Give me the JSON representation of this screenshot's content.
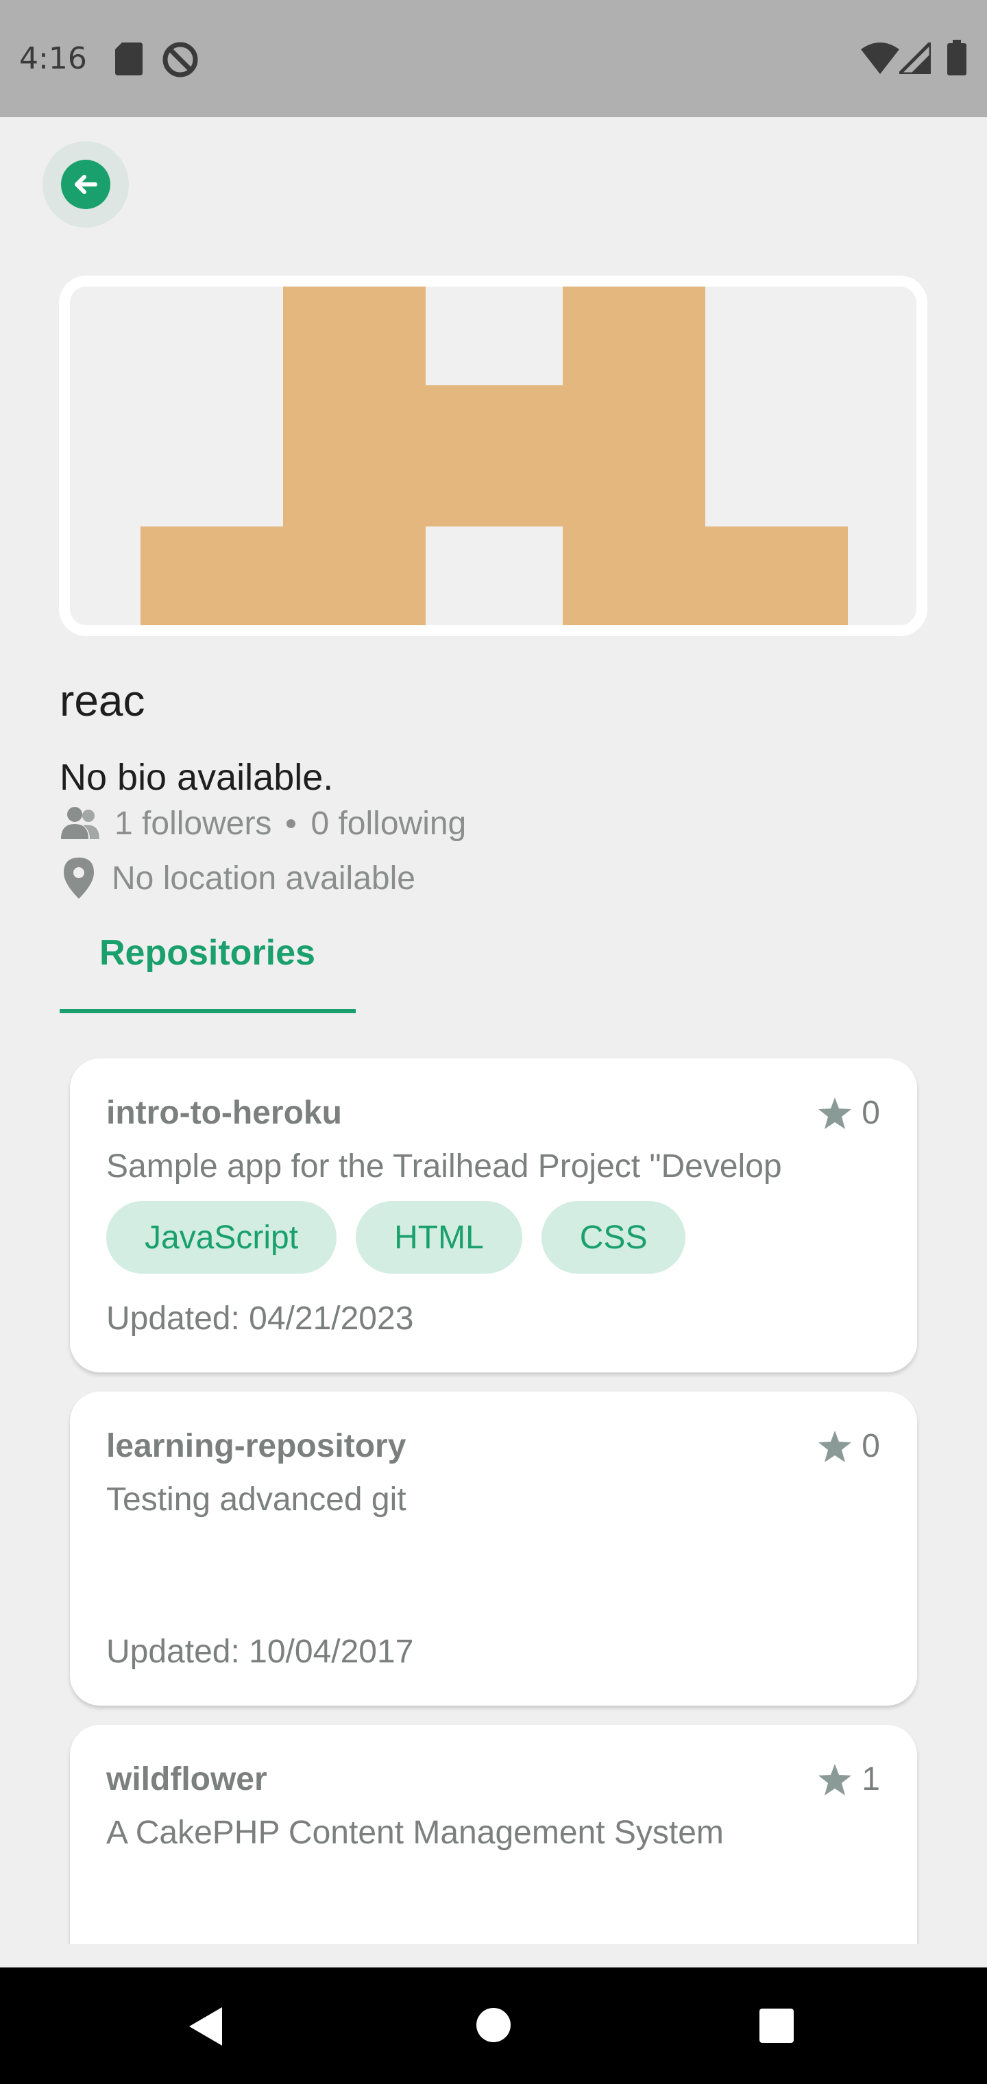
{
  "status_bar": {
    "time": "4:16",
    "icons": [
      "sd-card-icon",
      "do-not-disturb-icon",
      "wifi-icon",
      "signal-icon",
      "battery-icon"
    ]
  },
  "colors": {
    "accent": "#1aa06d",
    "chip_bg": "#d3ede3",
    "avatar_fill": "#e3b77e",
    "muted_text": "#7b7f7d"
  },
  "header": {
    "back_icon": "arrow-left-icon"
  },
  "profile": {
    "username": "reac",
    "bio": "No bio available.",
    "followers": "1 followers",
    "following": "0 following",
    "location": "No location available"
  },
  "tabs": [
    {
      "label": "Repositories",
      "selected": true
    }
  ],
  "repositories": [
    {
      "name": "intro-to-heroku",
      "stars": "0",
      "description": "Sample app for the Trailhead Project \"Develop",
      "languages": [
        "JavaScript",
        "HTML",
        "CSS"
      ],
      "updated": "Updated: 04/21/2023"
    },
    {
      "name": "learning-repository",
      "stars": "0",
      "description": "Testing advanced git",
      "languages": [],
      "updated": "Updated: 10/04/2017"
    },
    {
      "name": "wildflower",
      "stars": "1",
      "description": "A CakePHP Content Management System",
      "languages": [],
      "updated": ""
    }
  ],
  "nav_bar": {
    "buttons": [
      "back-triangle-icon",
      "home-circle-icon",
      "recents-square-icon"
    ]
  }
}
